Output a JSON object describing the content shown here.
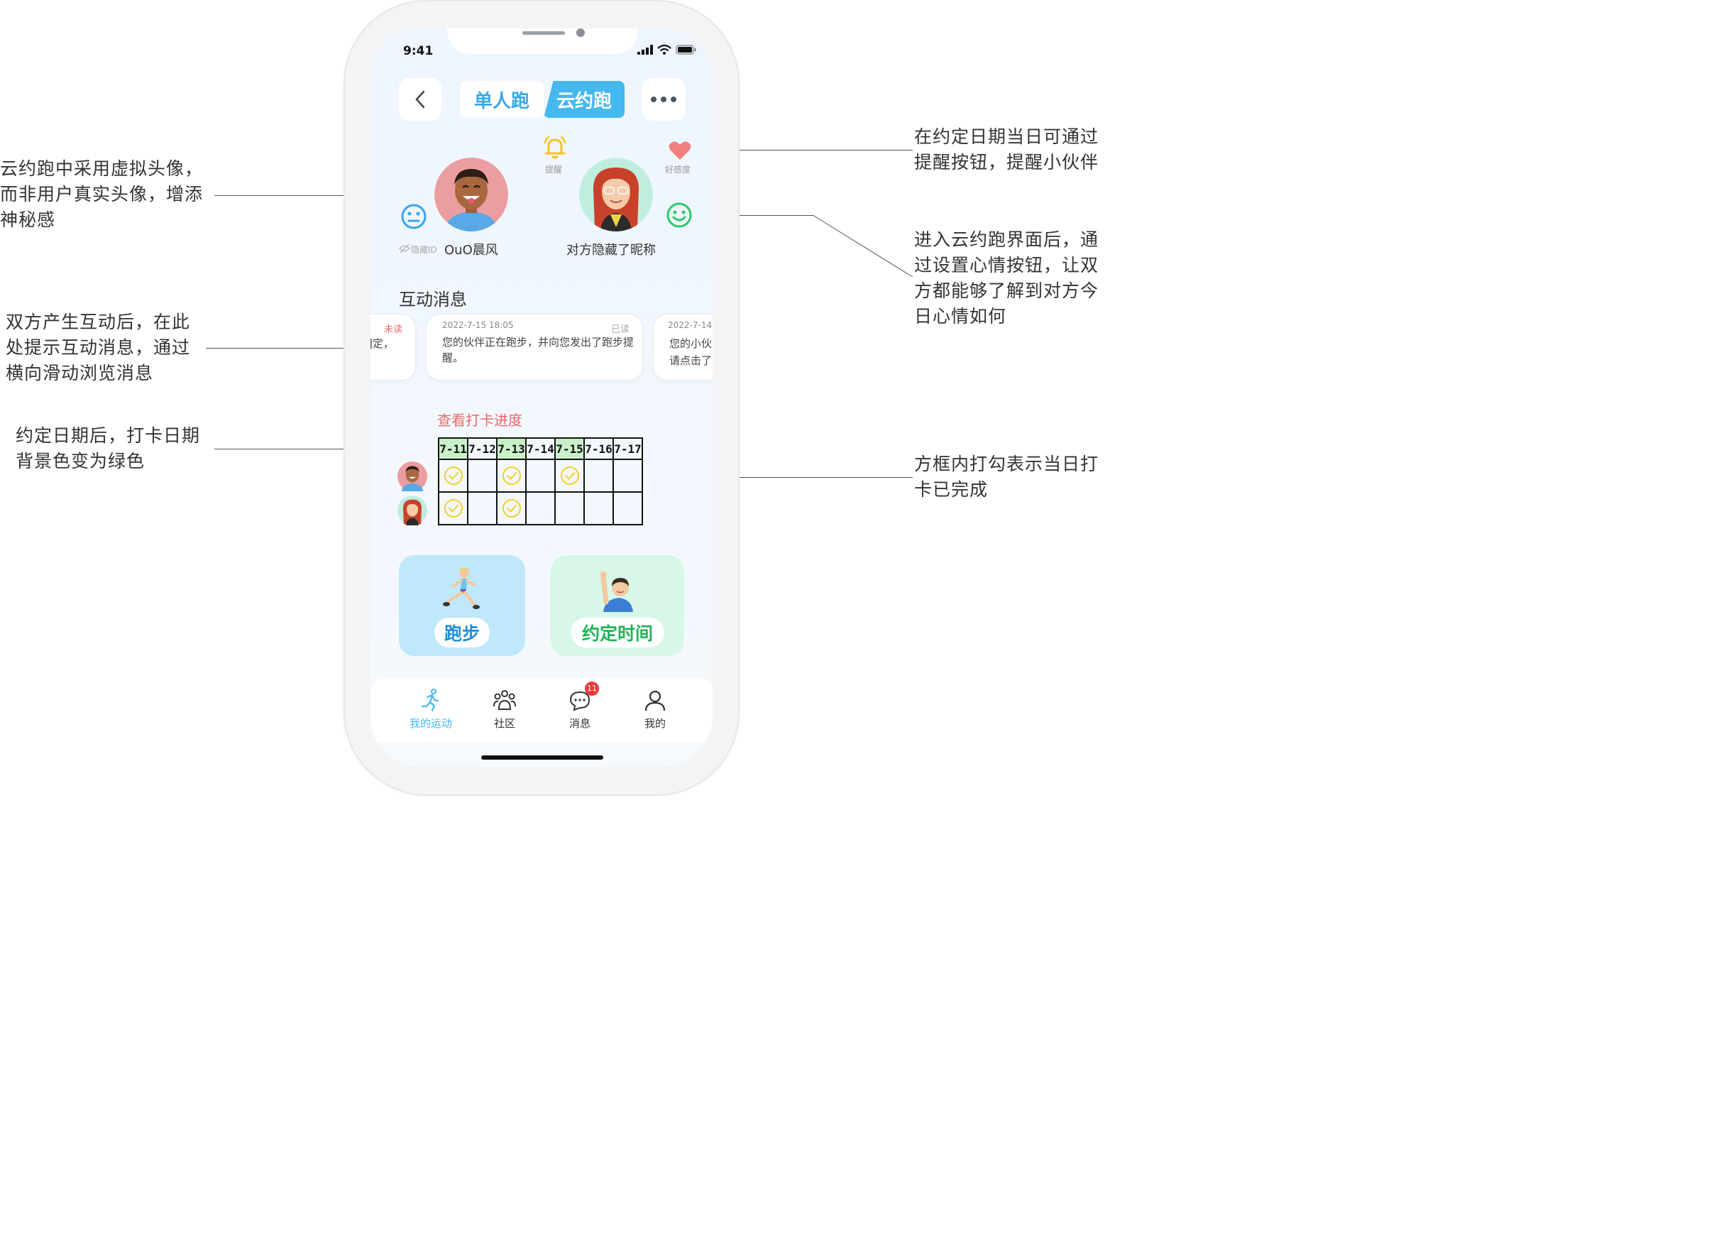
{
  "annotations": {
    "left_avatar": "云约跑中采用虚拟头像，\n而非用户真实头像，增添\n神秘感",
    "left_messages": "双方产生互动后，在此\n处提示互动消息，通过\n横向滑动浏览消息",
    "left_dates": "约定日期后，打卡日期\n背景色变为绿色",
    "right_remind": "在约定日期当日可通过\n提醒按钮，提醒小伙伴",
    "right_mood": "进入云约跑界面后，通\n过设置心情按钮，让双\n方都能够了解到对方今\n日心情如何",
    "right_check": "方框内打勾表示当日打\n卡已完成"
  },
  "status_bar": {
    "time": "9:41"
  },
  "header": {
    "tab_single": "单人跑",
    "tab_cloud": "云约跑"
  },
  "partner": {
    "remind_label": "提醒",
    "favor_label": "好感度",
    "me_hidden_id": "隐藏ID",
    "me_name": "OuO晨风",
    "other_name": "对方隐藏了昵称"
  },
  "messages": {
    "title": "互动消息",
    "items": [
      {
        "status": "未读",
        "text": "]定，"
      },
      {
        "date": "2022-7-15 18:05",
        "status": "已读",
        "text": "您的伙伴正在跑步，并向您发出了跑步提醒。"
      },
      {
        "date": "2022-7-14",
        "text_line1": "您的小伙",
        "text_line2": "请点击了"
      }
    ]
  },
  "checkin": {
    "title": "查看打卡进度",
    "dates": [
      "7-11",
      "7-12",
      "7-13",
      "7-14",
      "7-15",
      "7-16",
      "7-17"
    ],
    "green_dates": [
      true,
      false,
      true,
      false,
      true,
      false,
      false
    ],
    "me_checked": [
      true,
      false,
      true,
      false,
      true,
      false,
      false
    ],
    "partner_checked": [
      true,
      false,
      true,
      false,
      false,
      false,
      false
    ]
  },
  "actions": {
    "run": "跑步",
    "schedule": "约定时间"
  },
  "tabbar": {
    "items": [
      "我的运动",
      "社区",
      "消息",
      "我的"
    ],
    "message_badge": "11"
  },
  "colors": {
    "accent": "#45b8ee",
    "green_bg": "#c9f0c9",
    "check": "#f2d02a",
    "title_red": "#e96b6b"
  }
}
